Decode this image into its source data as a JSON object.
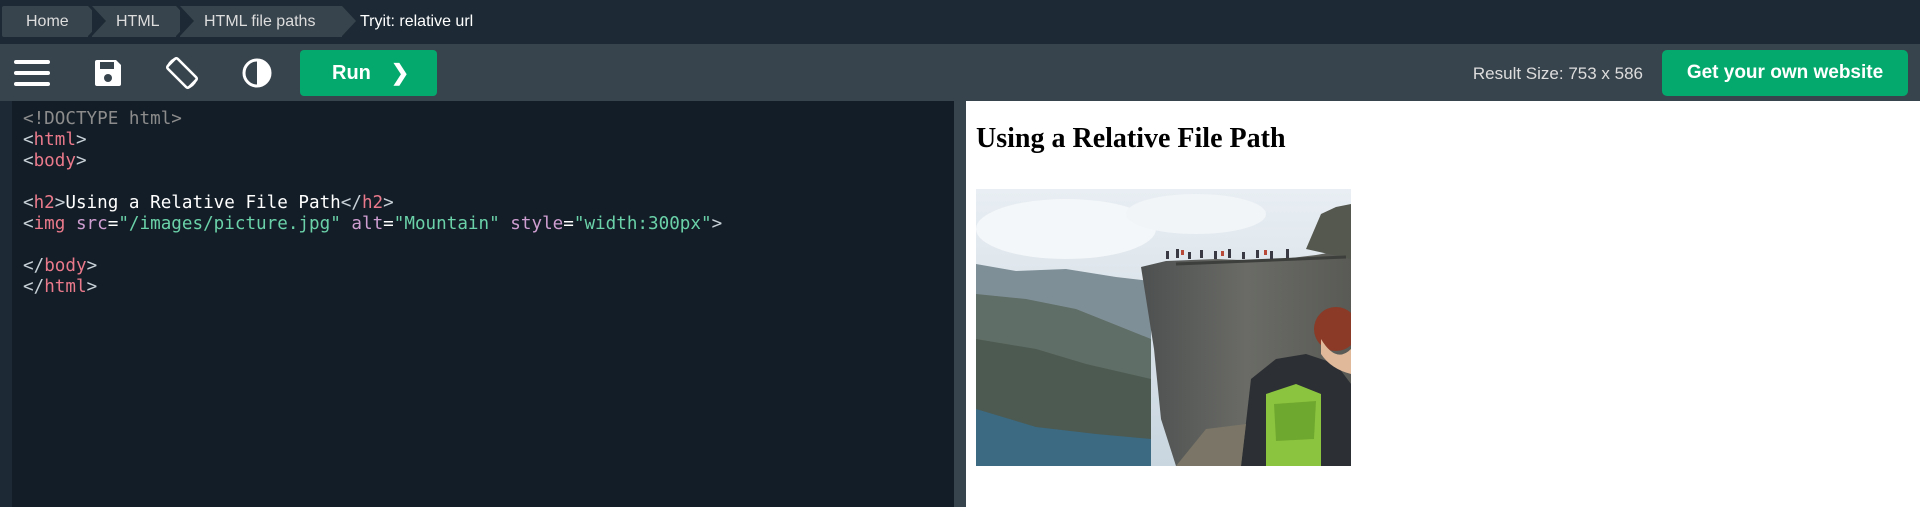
{
  "breadcrumb": {
    "items": [
      "Home",
      "HTML",
      "HTML file paths"
    ],
    "current": "Tryit: relative url"
  },
  "toolbar": {
    "icons": [
      "menu-icon",
      "save-icon",
      "rotate-icon",
      "contrast-icon"
    ],
    "run_label": "Run",
    "run_arrow": "❯",
    "result_size": "Result Size: 753 x 586",
    "get_website_label": "Get your own website"
  },
  "editor": {
    "lines": [
      [
        {
          "cls": "t-doc",
          "text": "<!DOCTYPE html>"
        }
      ],
      [
        {
          "cls": "bracket",
          "text": "<"
        },
        {
          "cls": "t-tag",
          "text": "html"
        },
        {
          "cls": "bracket",
          "text": ">"
        }
      ],
      [
        {
          "cls": "bracket",
          "text": "<"
        },
        {
          "cls": "t-tag",
          "text": "body"
        },
        {
          "cls": "bracket",
          "text": ">"
        }
      ],
      [],
      [
        {
          "cls": "bracket",
          "text": "<"
        },
        {
          "cls": "t-tag",
          "text": "h2"
        },
        {
          "cls": "bracket",
          "text": ">"
        },
        {
          "cls": "t-txt",
          "text": "Using a Relative File Path"
        },
        {
          "cls": "bracket",
          "text": "</"
        },
        {
          "cls": "t-tag",
          "text": "h2"
        },
        {
          "cls": "bracket",
          "text": ">"
        }
      ],
      [
        {
          "cls": "bracket",
          "text": "<"
        },
        {
          "cls": "t-tag",
          "text": "img"
        },
        {
          "cls": "t-attr",
          "text": " src"
        },
        {
          "cls": "t-br",
          "text": "="
        },
        {
          "cls": "t-val",
          "text": "\"/images/picture.jpg\""
        },
        {
          "cls": "t-attr",
          "text": " alt"
        },
        {
          "cls": "t-br",
          "text": "="
        },
        {
          "cls": "t-val",
          "text": "\"Mountain\""
        },
        {
          "cls": "t-attr",
          "text": " style"
        },
        {
          "cls": "t-br",
          "text": "="
        },
        {
          "cls": "t-val",
          "text": "\"width:300px\""
        },
        {
          "cls": "bracket",
          "text": ">"
        }
      ],
      [],
      [
        {
          "cls": "bracket",
          "text": "</"
        },
        {
          "cls": "t-tag",
          "text": "body"
        },
        {
          "cls": "bracket",
          "text": ">"
        }
      ],
      [
        {
          "cls": "bracket",
          "text": "</"
        },
        {
          "cls": "t-tag",
          "text": "html"
        },
        {
          "cls": "bracket",
          "text": ">"
        }
      ]
    ]
  },
  "result": {
    "heading": "Using a Relative File Path",
    "image_alt": "Mountain"
  },
  "colors": {
    "accent": "#04aa6d",
    "toolbar": "#38444d",
    "editor_bg": "#131d27"
  }
}
